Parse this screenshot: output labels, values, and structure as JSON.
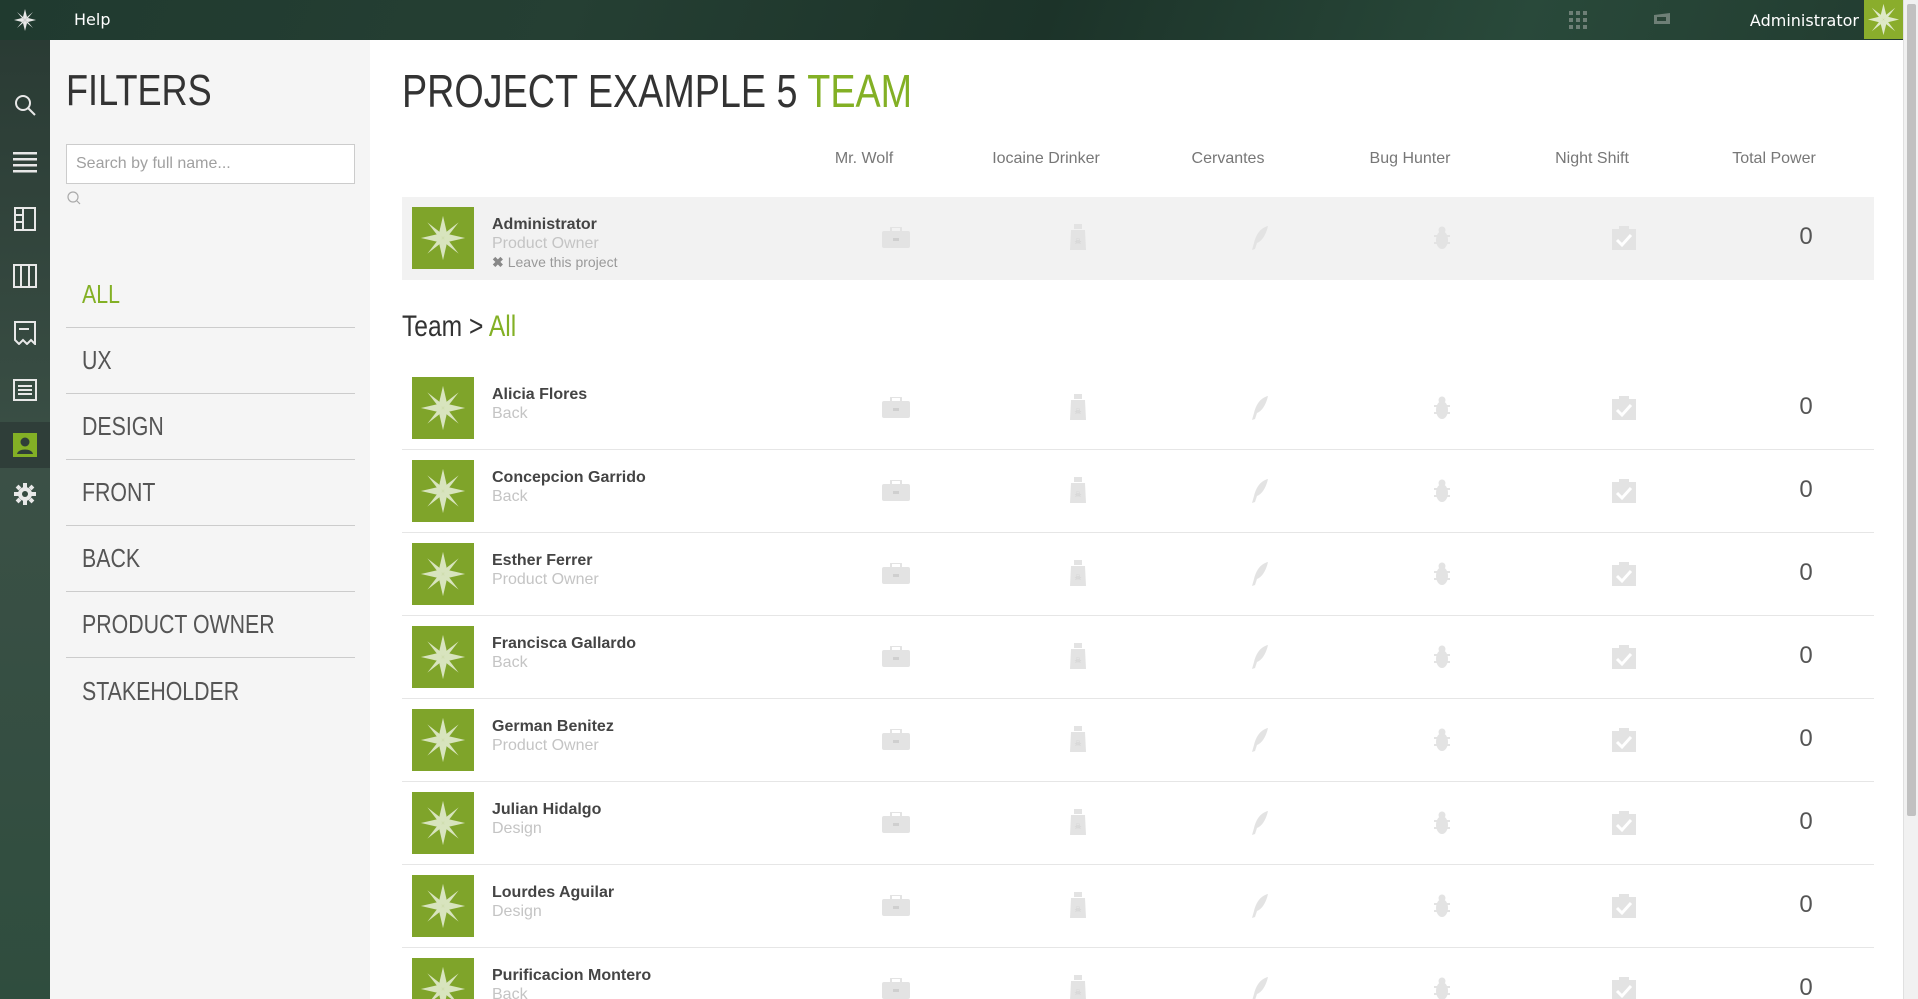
{
  "topbar": {
    "help_label": "Help",
    "user_label": "Administrator",
    "logo_icon": "taiga-logo-icon",
    "apps_icon": "apps-grid-icon",
    "notes_icon": "notifications-icon"
  },
  "nav": {
    "items": [
      {
        "icon": "search-icon"
      },
      {
        "icon": "backlog-icon"
      },
      {
        "icon": "kanban-icon"
      },
      {
        "icon": "board-icon"
      },
      {
        "icon": "issues-icon"
      },
      {
        "icon": "wiki-icon"
      },
      {
        "icon": "team-icon",
        "active": true
      },
      {
        "icon": "settings-icon"
      }
    ]
  },
  "filters": {
    "title": "FILTERS",
    "search_placeholder": "Search by full name...",
    "items": [
      "ALL",
      "UX",
      "DESIGN",
      "FRONT",
      "BACK",
      "PRODUCT OWNER",
      "STAKEHOLDER"
    ],
    "active": "ALL"
  },
  "page": {
    "title_main": "PROJECT EXAMPLE 5 ",
    "title_accent": "TEAM"
  },
  "columns": [
    "Mr. Wolf",
    "Iocaine Drinker",
    "Cervantes",
    "Bug Hunter",
    "Night Shift",
    "Total Power"
  ],
  "current_user": {
    "name": "Administrator",
    "role": "Product Owner",
    "leave_label": "Leave this project",
    "total": "0"
  },
  "team_heading": {
    "prefix": "Team > ",
    "accent": "All"
  },
  "members": [
    {
      "name": "Alicia Flores",
      "role": "Back",
      "total": "0"
    },
    {
      "name": "Concepcion Garrido",
      "role": "Back",
      "total": "0"
    },
    {
      "name": "Esther Ferrer",
      "role": "Product Owner",
      "total": "0"
    },
    {
      "name": "Francisca Gallardo",
      "role": "Back",
      "total": "0"
    },
    {
      "name": "German Benitez",
      "role": "Product Owner",
      "total": "0"
    },
    {
      "name": "Julian Hidalgo",
      "role": "Design",
      "total": "0"
    },
    {
      "name": "Lourdes Aguilar",
      "role": "Design",
      "total": "0"
    },
    {
      "name": "Purificacion Montero",
      "role": "Back",
      "total": "0"
    }
  ],
  "colors": {
    "accent": "#83b025",
    "avatar_bg": "#7fa42a",
    "nav_bg": "#2f4d3e"
  }
}
